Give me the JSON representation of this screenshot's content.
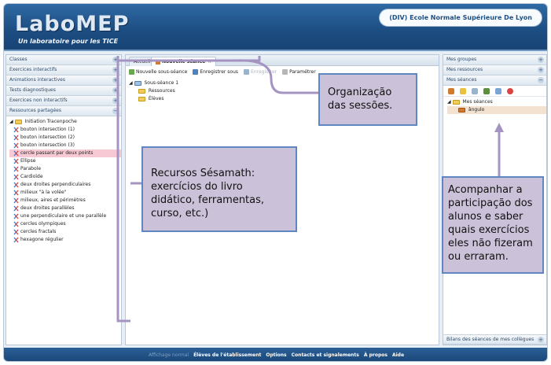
{
  "app": {
    "logo": "LaboMEP",
    "tagline": "Un laboratoire pour les TICE",
    "school": "(DIV) Ecole Normale Supérieure De Lyon"
  },
  "left": {
    "sections": [
      {
        "label": "Classes"
      },
      {
        "label": "Exercices interactifs"
      },
      {
        "label": "Animations interactives"
      },
      {
        "label": "Tests diagnostiques"
      },
      {
        "label": "Exercices non interactifs"
      },
      {
        "label": "Ressources partagées",
        "expanded": true
      }
    ],
    "tree_root": "Initiation Tracenpoche",
    "tree_items": [
      {
        "label": "bouton intersection (1)"
      },
      {
        "label": "bouton intersection (2)"
      },
      {
        "label": "bouton intersection (3)"
      },
      {
        "label": "cercle passant par deux points",
        "selected": true
      },
      {
        "label": "Ellipse"
      },
      {
        "label": "Parabole"
      },
      {
        "label": "Cardioïde"
      },
      {
        "label": "deux droites perpendiculaires"
      },
      {
        "label": "milieux \"à la volée\""
      },
      {
        "label": "milieux, aires et périmètres"
      },
      {
        "label": "deux droites parallèles"
      },
      {
        "label": "une perpendiculaire et une parallèle"
      },
      {
        "label": "cercles olympiques"
      },
      {
        "label": "cercles fractals"
      },
      {
        "label": "hexagone régulier"
      }
    ]
  },
  "center": {
    "tabs": [
      {
        "label": "Accueil"
      },
      {
        "label": "Nouvelle séance",
        "active": true
      }
    ],
    "toolbar": [
      {
        "label": "Nouvelle sous-séance",
        "disabled": false
      },
      {
        "label": "Enregistrer sous",
        "disabled": false
      },
      {
        "label": "Enregistrer",
        "disabled": true
      },
      {
        "label": "Paramétrer",
        "disabled": false
      }
    ],
    "tree": {
      "root": "Sous-séance 1",
      "children": [
        "Ressources",
        "Élèves"
      ]
    }
  },
  "right": {
    "sections": [
      {
        "label": "Mes groupes"
      },
      {
        "label": "Mes ressources"
      },
      {
        "label": "Mes séances",
        "expanded": true
      }
    ],
    "tree_root": "Mes séances",
    "tree_item": "ângulo",
    "bottom_label": "Bilans des séances de mes collègues"
  },
  "footer": {
    "items": [
      {
        "label": "Affichage normal",
        "muted": true
      },
      {
        "label": "Élèves de l'établissement"
      },
      {
        "label": "Options"
      },
      {
        "label": "Contacts et signalements"
      },
      {
        "label": "À propos"
      },
      {
        "label": "Aide"
      }
    ]
  },
  "annotations": {
    "organizacao": "Organização das sessões.",
    "recursos": "Recursos Sésamath: exercícios do livro didático, ferramentas, curso, etc.)",
    "acompanhar": "Acompanhar a participação dos alunos e saber quais exercícios eles não fizeram ou erraram."
  },
  "colors": {
    "header_blue": "#1d4f84",
    "annotation_fill": "#c7bcd6",
    "annotation_border": "#5f86c1",
    "bracket": "#a594c2",
    "selected_row": "#f6c9d4"
  }
}
